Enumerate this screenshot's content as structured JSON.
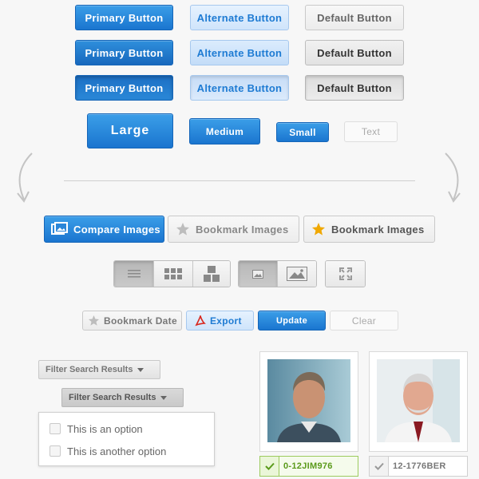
{
  "button_grid": {
    "rows": [
      {
        "primary": "Primary Button",
        "alternate": "Alternate Button",
        "default": "Default Button"
      },
      {
        "primary": "Primary Button",
        "alternate": "Alternate Button",
        "default": "Default Button"
      },
      {
        "primary": "Primary Button",
        "alternate": "Alternate Button",
        "default": "Default Button"
      }
    ]
  },
  "sizes": {
    "large": "Large",
    "medium": "Medium",
    "small": "Small",
    "text": "Text"
  },
  "image_actions": {
    "compare": "Compare Images",
    "bookmark_inactive": "Bookmark Images",
    "bookmark_active": "Bookmark Images"
  },
  "view_toggles": {
    "layout": [
      "list-view-icon",
      "grid-view-icon",
      "tile-view-icon"
    ],
    "image_size": [
      "small-image-icon",
      "large-image-icon"
    ],
    "fullscreen": "expand-icon"
  },
  "action_bar": {
    "bookmark_date": "Bookmark Date",
    "export": "Export",
    "update": "Update",
    "clear": "Clear"
  },
  "filters": {
    "collapsed_label": "Filter Search Results",
    "open_label": "Filter Search Results",
    "options": [
      "This is an option",
      "This is another option"
    ]
  },
  "photos": [
    {
      "id_label": "0-12JIM976",
      "selected": true
    },
    {
      "id_label": "12-1776BER",
      "selected": false
    }
  ],
  "colors": {
    "accent": "#1e7bd3",
    "selected_green": "#5a9a1a",
    "star_gold": "#f0a800"
  }
}
